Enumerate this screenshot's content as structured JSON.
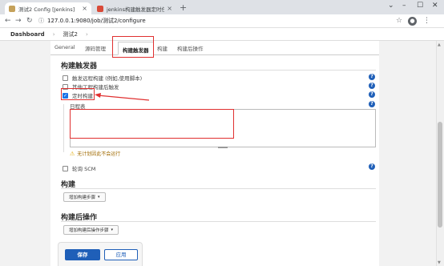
{
  "browser": {
    "tabs": [
      {
        "title": "测试2 Config [Jenkins]",
        "active": true
      },
      {
        "title": "jenkins构建触发器定时任务Build",
        "active": false
      }
    ],
    "url": "127.0.0.1:9080/job/测试2/configure",
    "newtab_symbol": "+",
    "window_controls": [
      "⌄",
      "–",
      "☐",
      "✕"
    ]
  },
  "breadcrumb": {
    "items": [
      "Dashboard",
      "测试2"
    ],
    "separator": "›"
  },
  "config_tabs": [
    "General",
    "源码管理",
    "构建触发器",
    "构建",
    "构建后操作"
  ],
  "active_tab": "构建触发器",
  "triggers": {
    "title": "构建触发器",
    "options": [
      {
        "label": "触发远程构建 (例如,使用脚本)",
        "checked": false
      },
      {
        "label": "其他工程构建后触发",
        "checked": false
      },
      {
        "label": "定时构建",
        "checked": true
      }
    ],
    "schedule_label": "日程表",
    "schedule_value": "",
    "warning": "无计划因此不会运行",
    "poll_scm_label": "轮询 SCM"
  },
  "build": {
    "title": "构建",
    "add_step_label": "增加构建步骤"
  },
  "post_build": {
    "title": "构建后操作",
    "add_step_label": "增加构建后操作步骤"
  },
  "actions": {
    "save_label": "保存",
    "apply_label": "应用"
  },
  "colors": {
    "annotation_red": "#e03030",
    "jenkins_blue": "#1f5fb8"
  }
}
